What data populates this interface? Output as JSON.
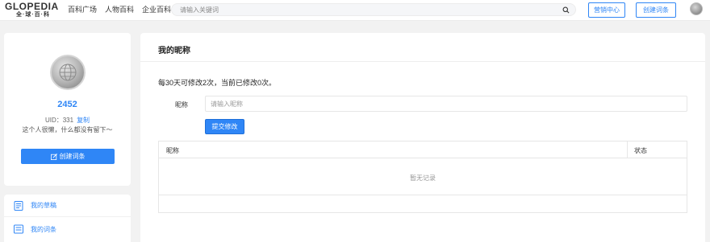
{
  "header": {
    "logo_text": "GLOPEDIA",
    "logo_sub": "全·球·百·科",
    "nav": [
      "百科广场",
      "人物百科",
      "企业百科"
    ],
    "search_placeholder": "请输入关键词",
    "marketing_label": "营销中心",
    "create_label": "创建词条"
  },
  "profile": {
    "username": "2452",
    "uid_text": "UID：331",
    "copy_label": "复制",
    "bio": "这个人很懒，什么都没有留下～",
    "create_button": "创建词条"
  },
  "menu": {
    "items": [
      {
        "label": "我的草稿",
        "icon": "draft-icon"
      },
      {
        "label": "我的词条",
        "icon": "entries-icon"
      }
    ]
  },
  "main": {
    "title": "我的昵称",
    "notice": "每30天可修改2次，当前已修改0次。",
    "field_label": "昵称",
    "input_placeholder": "请输入昵称",
    "submit_label": "提交修改",
    "table": {
      "columns": [
        "昵称",
        "状态"
      ],
      "empty_text": "暂无记录"
    }
  },
  "colors": {
    "accent": "#2f86f6",
    "page_bg": "#f2f2f2"
  }
}
